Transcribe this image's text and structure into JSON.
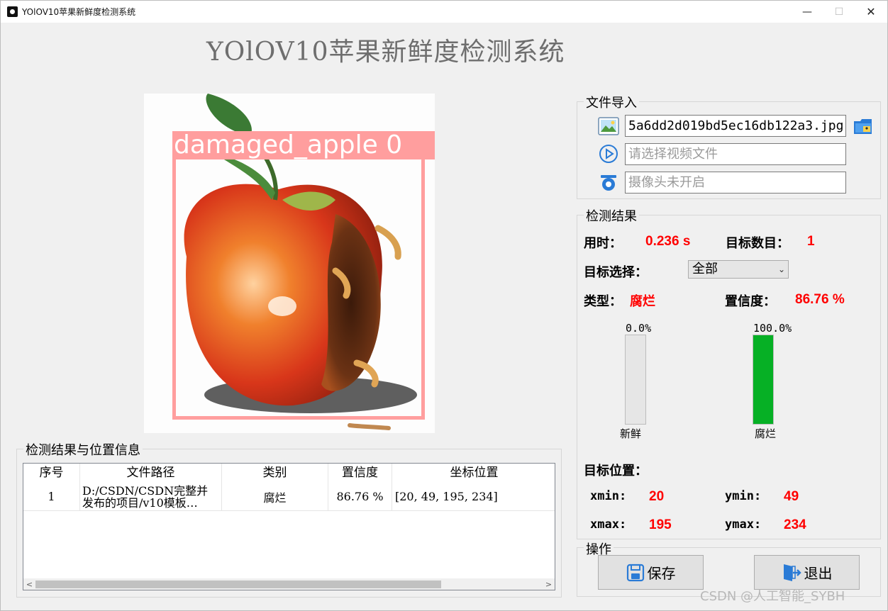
{
  "window": {
    "title": "YOlOV10苹果新鲜度检测系统",
    "min_glyph": "—",
    "max_glyph": "☐",
    "close_glyph": "✕"
  },
  "header": {
    "title": "YOlOV10苹果新鲜度检测系统"
  },
  "image_view": {
    "detection_label": "damaged_apple 0"
  },
  "file_import": {
    "title": "文件导入",
    "image_path": "5a6dd2d019bd5ec16db122a3.jpg",
    "video_placeholder": "请选择视频文件",
    "camera_placeholder": "摄像头未开启"
  },
  "results": {
    "title": "检测结果",
    "time_label": "用时：",
    "time_value": "0.236 s",
    "count_label": "目标数目：",
    "count_value": "1",
    "select_label": "目标选择：",
    "select_value": "全部",
    "type_label": "类型：",
    "type_value": "腐烂",
    "conf_label": "置信度：",
    "conf_value": "86.76 %",
    "bars": [
      {
        "name": "新鲜",
        "pct_text": "0.0%",
        "fraction": 0.0
      },
      {
        "name": "腐烂",
        "pct_text": "100.0%",
        "fraction": 1.0
      }
    ],
    "position_label": "目标位置：",
    "xmin_label": "xmin:",
    "xmin_value": "20",
    "ymin_label": "ymin:",
    "ymin_value": "49",
    "xmax_label": "xmax:",
    "xmax_value": "195",
    "ymax_label": "ymax:",
    "ymax_value": "234"
  },
  "table": {
    "title": "检测结果与位置信息",
    "columns": [
      "序号",
      "文件路径",
      "类别",
      "置信度",
      "坐标位置"
    ],
    "rows": [
      {
        "index": "1",
        "path_line1": "D:/CSDN/CSDN完整并",
        "path_line2": "发布的项目/v10模板…",
        "category": "腐烂",
        "confidence": "86.76 %",
        "coords": "[20, 49, 195, 234]"
      }
    ],
    "scroll_left": "<",
    "scroll_right": ">"
  },
  "actions": {
    "title": "操作",
    "save_label": "保存",
    "exit_label": "退出"
  },
  "watermark": "CSDN @人工智能_SYBH",
  "colors": {
    "accent_value": "#ff0000",
    "bbox": "#ff9e9e",
    "progress": "#06b025"
  }
}
